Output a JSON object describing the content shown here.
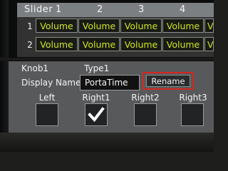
{
  "slider_grid": {
    "title": "Slider",
    "columns": [
      "1",
      "2",
      "3",
      "4"
    ],
    "rows": [
      {
        "label": "1",
        "cells": [
          "Volume",
          "Volume",
          "Volume",
          "Volume",
          "V"
        ]
      },
      {
        "label": "2",
        "cells": [
          "Volume",
          "Volume",
          "Volume",
          "Volume",
          "V"
        ]
      }
    ]
  },
  "knob_panel": {
    "knob_label": "Knob1",
    "type_label": "Type1",
    "display_name_label": "Display Name:",
    "display_name_value": "PortaTime",
    "rename_label": "Rename",
    "options": [
      {
        "label": "Left",
        "checked": false
      },
      {
        "label": "Right1",
        "checked": true
      },
      {
        "label": "Right2",
        "checked": false
      },
      {
        "label": "Right3",
        "checked": false
      }
    ]
  },
  "colors": {
    "cell_text": "#cfe61e",
    "checkmark": "#ffffff",
    "highlight_border": "#d7261f"
  },
  "icons": {
    "check": "checkmark-icon"
  }
}
